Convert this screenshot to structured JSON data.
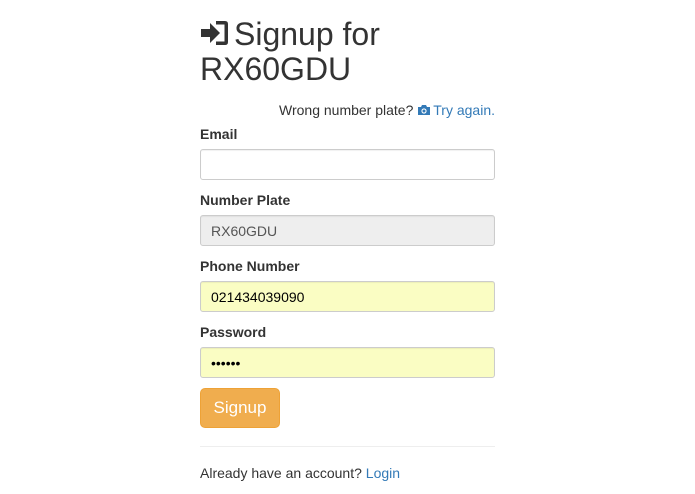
{
  "header": {
    "title_prefix": "Signup for",
    "plate": "RX60GDU"
  },
  "wrong_plate": {
    "text": "Wrong number plate?",
    "link": "Try again."
  },
  "form": {
    "email": {
      "label": "Email",
      "value": ""
    },
    "number_plate": {
      "label": "Number Plate",
      "value": "RX60GDU"
    },
    "phone": {
      "label": "Phone Number",
      "value": "021434039090"
    },
    "password": {
      "label": "Password",
      "value": "••••••"
    },
    "submit_label": "Signup"
  },
  "footer": {
    "text": "Already have an account?",
    "link": "Login"
  },
  "colors": {
    "link": "#337ab7",
    "button": "#f0ad4e",
    "autofill": "#fafdc3",
    "readonly": "#eeeeee"
  },
  "icons": {
    "title": "sign-in-icon",
    "retry": "camera-icon"
  }
}
